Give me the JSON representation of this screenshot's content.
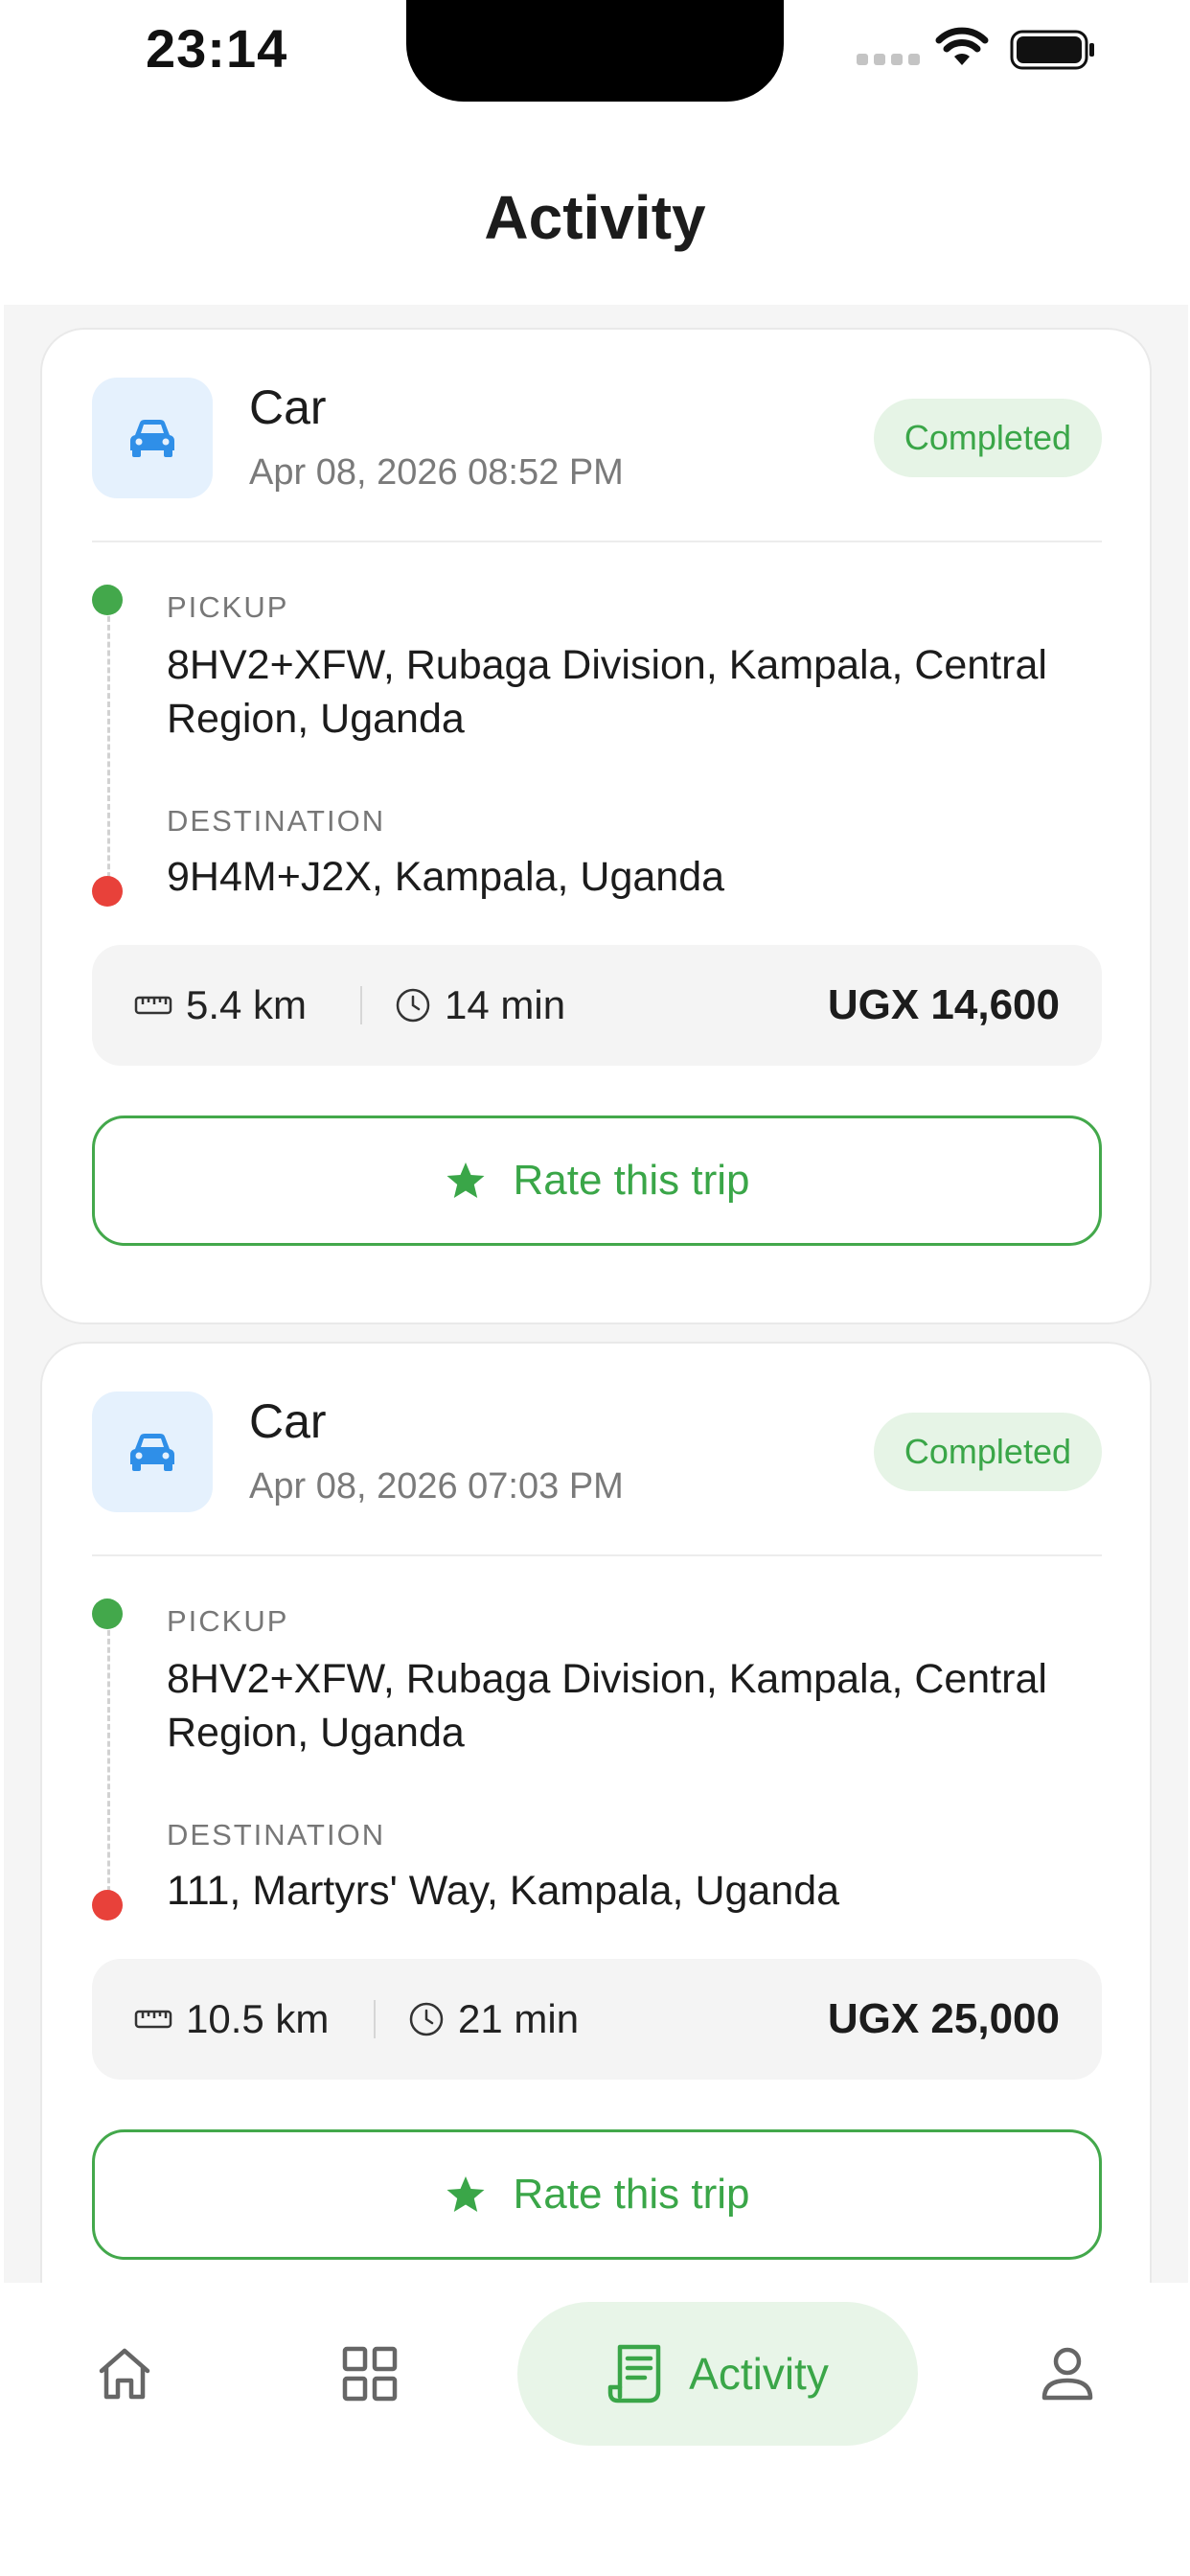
{
  "status_bar": {
    "time": "23:14"
  },
  "header": {
    "title": "Activity"
  },
  "trips": [
    {
      "vehicle": "Car",
      "date": "Apr 08, 2026 08:52 PM",
      "status": "Completed",
      "pickup_label": "PICKUP",
      "pickup_address": "8HV2+XFW, Rubaga Division, Kampala, Central Region, Uganda",
      "destination_label": "DESTINATION",
      "destination_address": "9H4M+J2X, Kampala, Uganda",
      "distance": "5.4 km",
      "duration": "14 min",
      "fare": "UGX 14,600",
      "rate_label": "Rate this trip"
    },
    {
      "vehicle": "Car",
      "date": "Apr 08, 2026 07:03 PM",
      "status": "Completed",
      "pickup_label": "PICKUP",
      "pickup_address": "8HV2+XFW, Rubaga Division, Kampala, Central Region, Uganda",
      "destination_label": "DESTINATION",
      "destination_address": "111, Martyrs' Way, Kampala, Uganda",
      "distance": "10.5 km",
      "duration": "21 min",
      "fare": "UGX 25,000",
      "rate_label": "Rate this trip"
    }
  ],
  "nav": {
    "active_label": "Activity",
    "items": [
      "home-icon",
      "grid-icon",
      "receipt-icon",
      "person-icon"
    ]
  },
  "colors": {
    "accent_green": "#43a84b",
    "destination_red": "#e8413a",
    "vehicle_blue": "#2f8fe8",
    "badge_bg": "#e6f4e6"
  }
}
